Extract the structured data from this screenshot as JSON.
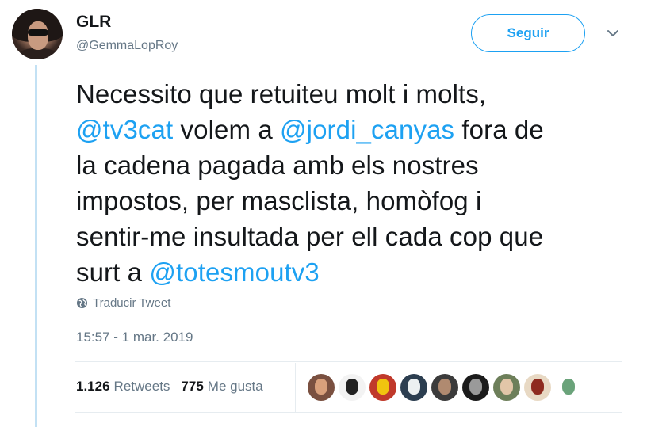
{
  "author": {
    "name": "GLR",
    "handle": "@GemmaLopRoy"
  },
  "follow_button": {
    "label": "Seguir"
  },
  "tweet": {
    "lines": [
      [
        {
          "text": "Necessito que retuiteu molt i molts,",
          "type": "text"
        }
      ],
      [
        {
          "text": "@tv3cat",
          "type": "mention"
        },
        {
          "text": " volem a ",
          "type": "text"
        },
        {
          "text": "@jordi_canyas",
          "type": "mention"
        },
        {
          "text": " fora de",
          "type": "text"
        }
      ],
      [
        {
          "text": "la cadena pagada amb els nostres",
          "type": "text"
        }
      ],
      [
        {
          "text": "impostos, per masclista, homòfog i",
          "type": "text"
        }
      ],
      [
        {
          "text": "sentir-me insultada per ell cada cop que",
          "type": "text"
        }
      ],
      [
        {
          "text": "surt a ",
          "type": "text"
        },
        {
          "text": "@totesmoutv3",
          "type": "mention"
        }
      ]
    ]
  },
  "translate": {
    "label": "Traducir Tweet",
    "icon": "globe-icon"
  },
  "timestamp": "15:57 - 1 mar. 2019",
  "stats": {
    "retweets_count": "1.126",
    "retweets_label": "Retweets",
    "likes_count": "775",
    "likes_label": "Me gusta"
  },
  "likers": [
    {
      "name": "liker-avatar-1",
      "bg": "#7a5040",
      "fg": "#d9a07c"
    },
    {
      "name": "liker-avatar-2",
      "bg": "#f3f3f3",
      "fg": "#222222"
    },
    {
      "name": "liker-avatar-3",
      "bg": "#c0392b",
      "fg": "#f1c40f"
    },
    {
      "name": "liker-avatar-4",
      "bg": "#2c3e50",
      "fg": "#ecf0f1"
    },
    {
      "name": "liker-avatar-5",
      "bg": "#3b3b3b",
      "fg": "#b08a70"
    },
    {
      "name": "liker-avatar-6",
      "bg": "#1b1b1b",
      "fg": "#9a9a9a"
    },
    {
      "name": "liker-avatar-7",
      "bg": "#6d7f5a",
      "fg": "#e2c6a8"
    },
    {
      "name": "liker-avatar-8",
      "bg": "#e8d9c4",
      "fg": "#8e2b1f"
    },
    {
      "name": "liker-avatar-9",
      "bg": "#ffffff",
      "fg": "#6aa37a"
    }
  ],
  "colors": {
    "accent": "#1da1f2",
    "secondary_text": "#657786",
    "thread_line": "#c3e1f4"
  }
}
